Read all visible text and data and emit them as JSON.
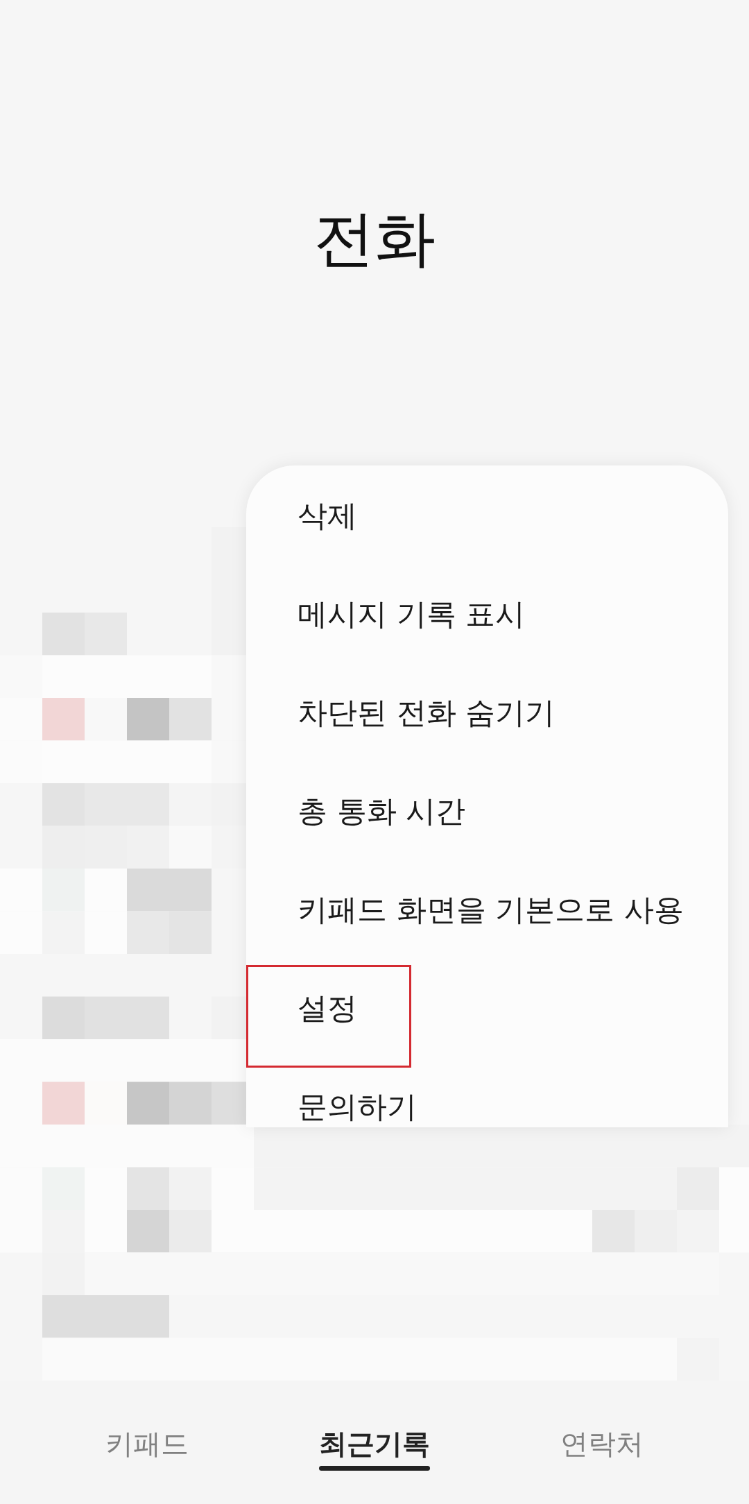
{
  "app_bar": {
    "title": "전화"
  },
  "menu": {
    "items": [
      {
        "label": "삭제",
        "highlighted": false
      },
      {
        "label": "메시지 기록 표시",
        "highlighted": false
      },
      {
        "label": "차단된 전화 숨기기",
        "highlighted": false
      },
      {
        "label": "총 통화 시간",
        "highlighted": false
      },
      {
        "label": "키패드 화면을 기본으로 사용",
        "highlighted": false
      },
      {
        "label": "설정",
        "highlighted": true
      },
      {
        "label": "문의하기",
        "highlighted": false
      }
    ]
  },
  "bottom_nav": {
    "tabs": [
      {
        "label": "키패드",
        "selected": false
      },
      {
        "label": "최근기록",
        "selected": true
      },
      {
        "label": "연락처",
        "selected": false
      }
    ]
  }
}
